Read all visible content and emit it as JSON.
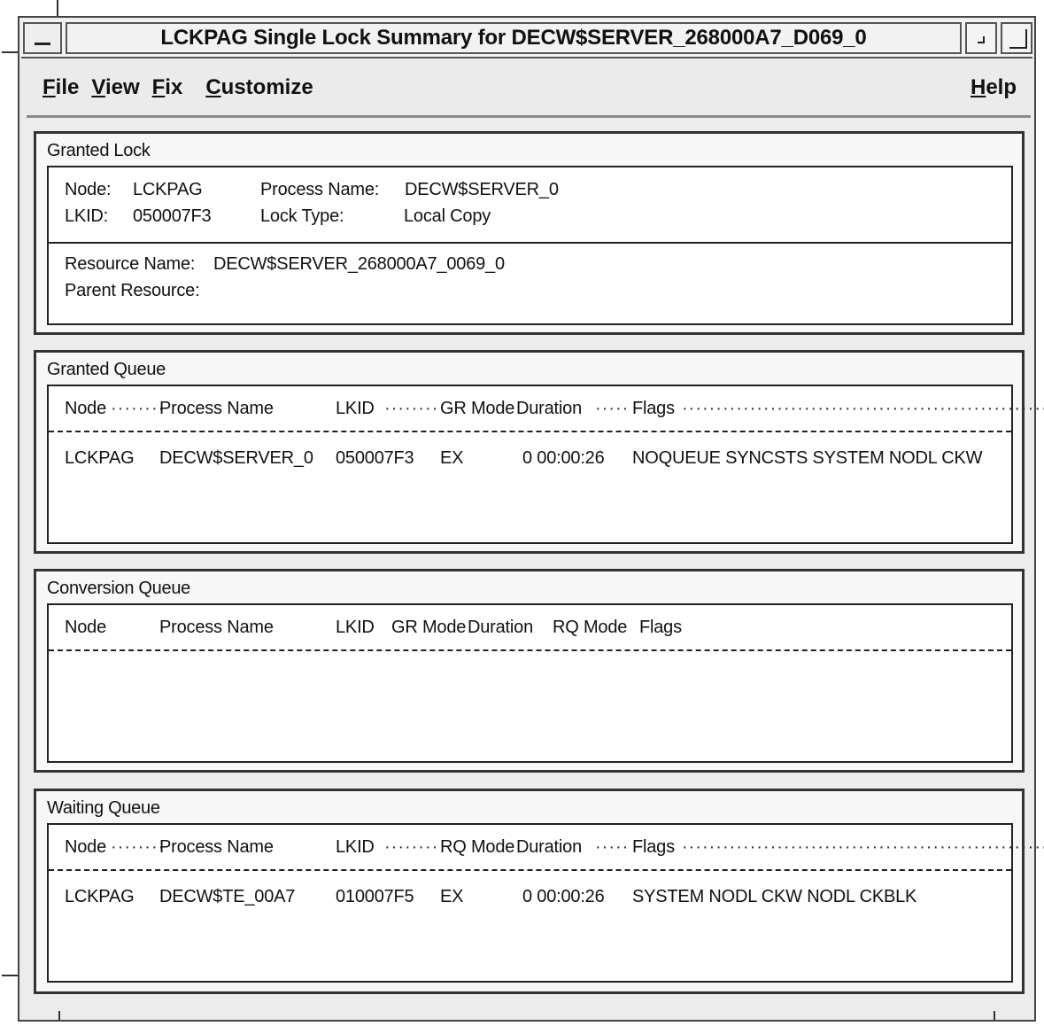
{
  "window": {
    "title": "LCKPAG Single Lock Summary for DECW$SERVER_268000A7_D069_0"
  },
  "menubar": {
    "items": [
      "File",
      "View",
      "Fix",
      "Customize"
    ],
    "help": "Help"
  },
  "granted_lock": {
    "label": "Granted Lock",
    "node_label": "Node:",
    "node": "LCKPAG",
    "lkid_label": "LKID:",
    "lkid": "050007F3",
    "process_name_label": "Process Name:",
    "process_name": "DECW$SERVER_0",
    "lock_type_label": "Lock Type:",
    "lock_type": "Local Copy",
    "resource_name_label": "Resource Name:",
    "resource_name": "DECW$SERVER_268000A7_0069_0",
    "parent_resource_label": "Parent Resource:",
    "parent_resource": ""
  },
  "granted_queue": {
    "label": "Granted Queue",
    "headers": {
      "node": "Node",
      "process_name": "Process Name",
      "lkid": "LKID",
      "mode": "GR Mode",
      "duration": "Duration",
      "flags": "Flags"
    },
    "rows": [
      {
        "node": "LCKPAG",
        "process_name": "DECW$SERVER_0",
        "lkid": "050007F3",
        "mode": "EX",
        "duration": "0 00:00:26",
        "flags": "NOQUEUE SYNCSTS SYSTEM NODL CKW"
      }
    ]
  },
  "conversion_queue": {
    "label": "Conversion Queue",
    "headers": {
      "node": "Node",
      "process_name": "Process Name",
      "lkid": "LKID",
      "gr_mode": "GR Mode",
      "duration": "Duration",
      "rq_mode": "RQ Mode",
      "flags": "Flags"
    },
    "rows": []
  },
  "waiting_queue": {
    "label": "Waiting Queue",
    "headers": {
      "node": "Node",
      "process_name": "Process Name",
      "lkid": "LKID",
      "mode": "RQ Mode",
      "duration": "Duration",
      "flags": "Flags"
    },
    "rows": [
      {
        "node": "LCKPAG",
        "process_name": "DECW$TE_00A7",
        "lkid": "010007F5",
        "mode": "EX",
        "duration": "0 00:00:26",
        "flags": "SYSTEM NODL CKW NODL CKBLK"
      }
    ]
  }
}
